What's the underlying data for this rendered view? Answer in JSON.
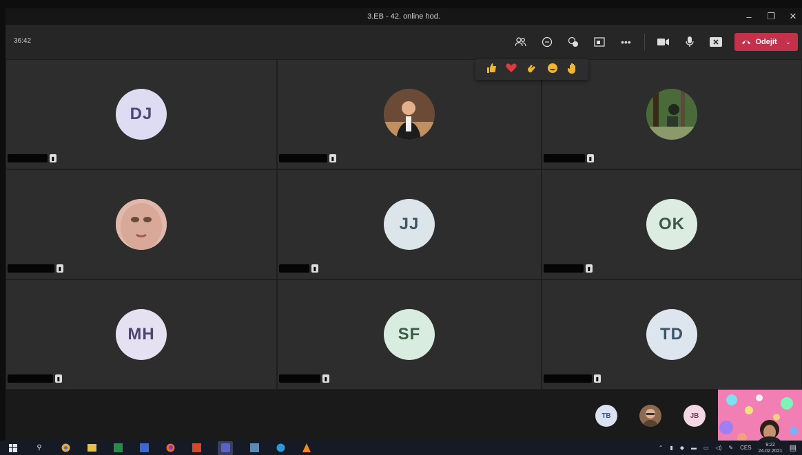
{
  "window": {
    "title": "3.EB - 42. online hod."
  },
  "meeting": {
    "timer": "36:42",
    "leave_label": "Odejít"
  },
  "toolbar": {
    "icons": [
      "people-icon",
      "chat-icon",
      "reactions-icon",
      "rooms-icon",
      "more-icon",
      "camera-icon",
      "mic-icon",
      "share-icon"
    ]
  },
  "reactions": [
    "like",
    "heart",
    "applause",
    "laugh",
    "raise-hand"
  ],
  "participants": [
    {
      "initials": "DJ",
      "type": "initials",
      "color": "#dedcf2",
      "text_color": "#4a4a78"
    },
    {
      "initials": "",
      "type": "photo",
      "color": "#6b4a36",
      "text_color": ""
    },
    {
      "initials": "",
      "type": "photo",
      "color": "#5a7a4a",
      "text_color": ""
    },
    {
      "initials": "",
      "type": "photo",
      "color": "#d8b0a8",
      "text_color": ""
    },
    {
      "initials": "JJ",
      "type": "initials",
      "color": "#dbe5ea",
      "text_color": "#3e5563"
    },
    {
      "initials": "OK",
      "type": "initials",
      "color": "#dcece1",
      "text_color": "#3d5a45"
    },
    {
      "initials": "MH",
      "type": "initials",
      "color": "#e6e1f2",
      "text_color": "#4c4670"
    },
    {
      "initials": "SF",
      "type": "initials",
      "color": "#d9ece0",
      "text_color": "#3c5b45"
    },
    {
      "initials": "TD",
      "type": "initials",
      "color": "#dde6ee",
      "text_color": "#3d5566"
    }
  ],
  "overflow": [
    {
      "initials": "TB",
      "color": "#dbe3f2",
      "text_color": "#3a4f80"
    },
    {
      "initials": "",
      "color": "#8a6a50",
      "text_color": ""
    },
    {
      "initials": "JB",
      "color": "#f2d8e2",
      "text_color": "#7a3a55"
    }
  ],
  "taskbar": {
    "time": "9:22",
    "date": "24.02.2021",
    "lang": "CES"
  }
}
